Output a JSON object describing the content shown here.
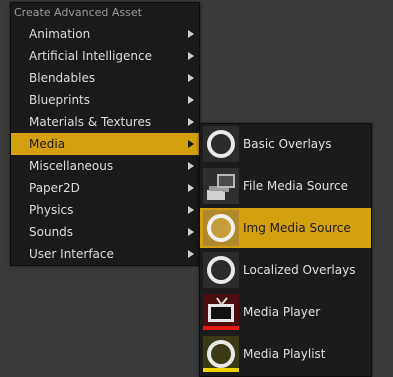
{
  "menu": {
    "header": "Create Advanced Asset",
    "items": [
      {
        "label": "Animation"
      },
      {
        "label": "Artificial Intelligence"
      },
      {
        "label": "Blendables"
      },
      {
        "label": "Blueprints"
      },
      {
        "label": "Materials & Textures"
      },
      {
        "label": "Media",
        "active": true
      },
      {
        "label": "Miscellaneous"
      },
      {
        "label": "Paper2D"
      },
      {
        "label": "Physics"
      },
      {
        "label": "Sounds"
      },
      {
        "label": "User Interface"
      }
    ]
  },
  "submenu": {
    "items": [
      {
        "label": "Basic Overlays",
        "icon": "overlay-ring-icon"
      },
      {
        "label": "File Media Source",
        "icon": "file-media-source-icon"
      },
      {
        "label": "Img Media Source",
        "icon": "img-media-source-icon",
        "active": true
      },
      {
        "label": "Localized Overlays",
        "icon": "overlay-ring-icon"
      },
      {
        "label": "Media Player",
        "icon": "tv-icon",
        "accent": "#e01818"
      },
      {
        "label": "Media Playlist",
        "icon": "playlist-ring-icon",
        "accent": "#ecd400"
      }
    ]
  },
  "colors": {
    "highlight": "#d4a00f",
    "background": "#3b3b3b",
    "menu_bg": "#1a1a1a"
  }
}
